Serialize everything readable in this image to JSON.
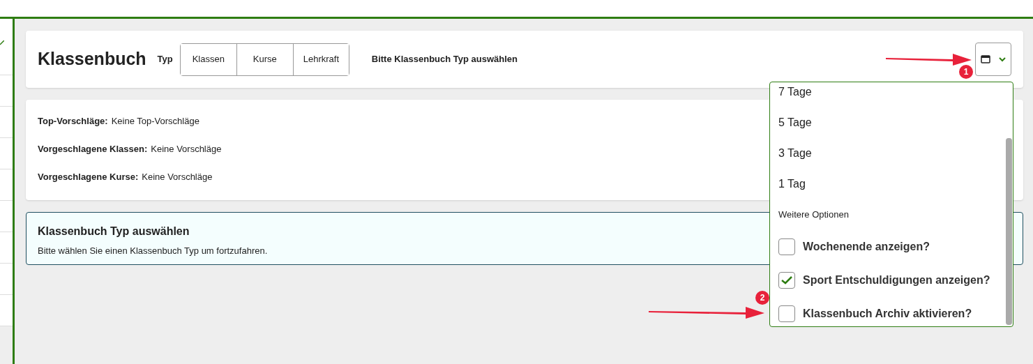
{
  "header": {
    "title": "Klassenbuch",
    "type_label": "Typ",
    "type_buttons": [
      {
        "label": "Klassen",
        "selected": false
      },
      {
        "label": "Kurse",
        "selected": false
      },
      {
        "label": "Lehrkraft",
        "selected": false
      }
    ],
    "hint": "Bitte Klassenbuch Typ auswählen"
  },
  "suggestions": [
    {
      "label": "Top-Vorschläge:",
      "value": "Keine Top-Vorschläge"
    },
    {
      "label": "Vorgeschlagene Klassen:",
      "value": "Keine Vorschläge"
    },
    {
      "label": "Vorgeschlagene Kurse:",
      "value": "Keine Vorschläge"
    }
  ],
  "info": {
    "title": "Klassenbuch Typ auswählen",
    "text": "Bitte wählen Sie einen Klassenbuch Typ um fortzufahren."
  },
  "dropdown": {
    "expanded": true,
    "items": [
      {
        "kind": "option",
        "label": "7 Tage"
      },
      {
        "kind": "option",
        "label": "5 Tage"
      },
      {
        "kind": "option",
        "label": "3 Tage"
      },
      {
        "kind": "option",
        "label": "1 Tag"
      },
      {
        "kind": "heading",
        "label": "Weitere Optionen"
      },
      {
        "kind": "checkbox",
        "label": "Wochenende anzeigen?",
        "checked": false
      },
      {
        "kind": "checkbox",
        "label": "Sport Entschuldigungen anzeigen?",
        "checked": true
      },
      {
        "kind": "checkbox",
        "label": "Klassenbuch Archiv aktivieren?",
        "checked": false
      }
    ]
  },
  "annotations": [
    "1",
    "2"
  ]
}
